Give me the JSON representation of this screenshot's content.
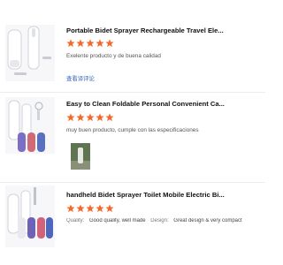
{
  "reviews": [
    {
      "title": "Portable Bidet Sprayer Rechargeable Travel Ele...",
      "rating": 5,
      "comment": "Exelente producto y de buena calidad",
      "link": "查看译评论"
    },
    {
      "title": "Easy to Clean Foldable Personal Convenient Ca...",
      "rating": 5,
      "comment": "muy buen producto, cumple con las especificaciones"
    },
    {
      "title": "handheld Bidet Sprayer Toilet Mobile Electric Bi...",
      "rating": 5,
      "attributes": [
        {
          "label": "Quality:",
          "value": "Good quality, well made"
        },
        {
          "label": "Design:",
          "value": "Great design & very compact"
        }
      ]
    }
  ],
  "colors": {
    "star": "#f2692b",
    "link": "#3a66b8",
    "title": "#111111",
    "comment": "#555555"
  },
  "icons": {
    "star": "star-icon"
  }
}
